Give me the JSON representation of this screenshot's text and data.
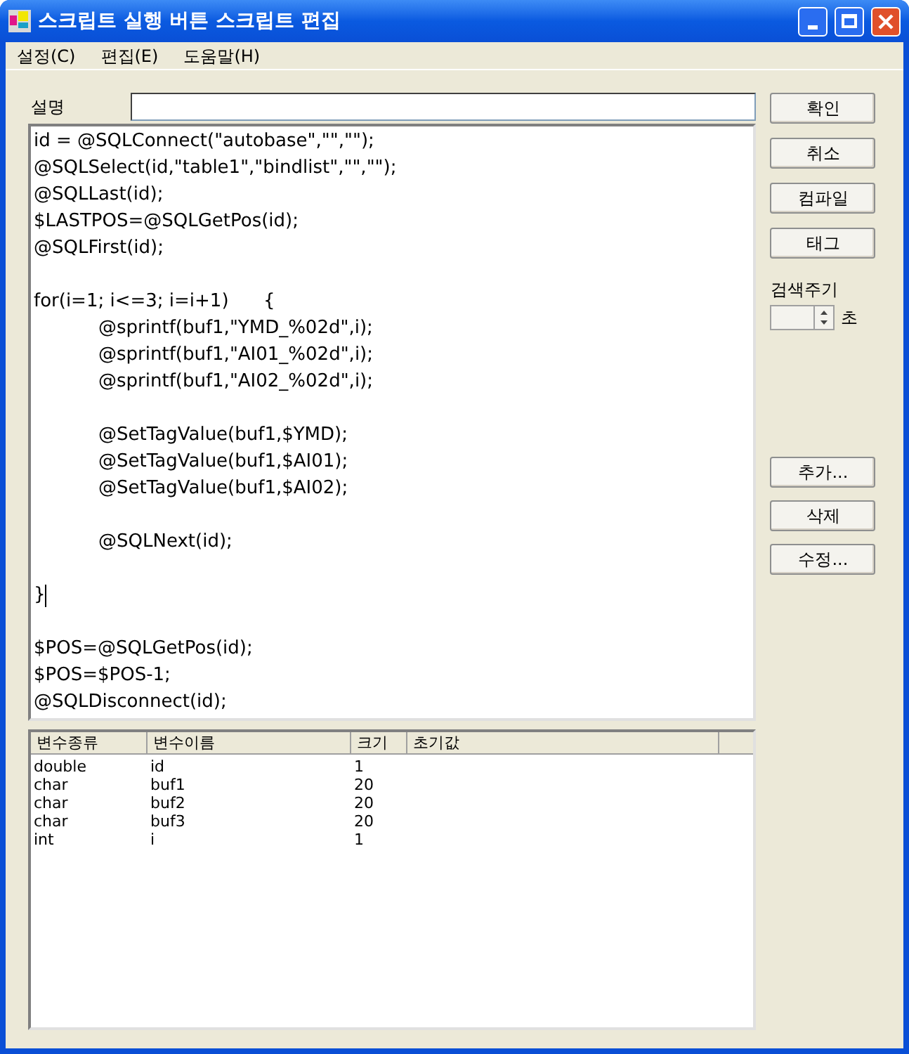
{
  "window": {
    "title": "스크립트 실행 버튼 스크립트 편집"
  },
  "menu": [
    "설정(C)",
    "편집(E)",
    "도움말(H)"
  ],
  "description": {
    "label": "설명"
  },
  "code": [
    {
      "kind": "line",
      "text": "id = @SQLConnect(\"autobase\",\"\",\"\");",
      "indent": false
    },
    {
      "kind": "line",
      "text": "@SQLSelect(id,\"table1\",\"bindlist\",\"\",\"\");",
      "indent": false
    },
    {
      "kind": "line",
      "text": "@SQLLast(id);",
      "indent": false
    },
    {
      "kind": "line",
      "text": "$LASTPOS=@SQLGetPos(id);",
      "indent": false
    },
    {
      "kind": "line",
      "text": "@SQLFirst(id);",
      "indent": false
    },
    {
      "kind": "blank"
    },
    {
      "kind": "line",
      "text": "for(i=1; i<=3; i=i+1)      {",
      "indent": false
    },
    {
      "kind": "line",
      "text": "@sprintf(buf1,\"YMD_%02d\",i);",
      "indent": true
    },
    {
      "kind": "line",
      "text": "@sprintf(buf1,\"AI01_%02d\",i);",
      "indent": true
    },
    {
      "kind": "line",
      "text": "@sprintf(buf1,\"AI02_%02d\",i);",
      "indent": true
    },
    {
      "kind": "blank"
    },
    {
      "kind": "line",
      "text": "@SetTagValue(buf1,$YMD);",
      "indent": true
    },
    {
      "kind": "line",
      "text": "@SetTagValue(buf1,$AI01);",
      "indent": true
    },
    {
      "kind": "line",
      "text": "@SetTagValue(buf1,$AI02);",
      "indent": true
    },
    {
      "kind": "blank"
    },
    {
      "kind": "line",
      "text": "@SQLNext(id);",
      "indent": true
    },
    {
      "kind": "blank"
    },
    {
      "kind": "caret",
      "text": "}",
      "indent": false
    },
    {
      "kind": "blank"
    },
    {
      "kind": "line",
      "text": "$POS=@SQLGetPos(id);",
      "indent": false
    },
    {
      "kind": "line",
      "text": "$POS=$POS-1;",
      "indent": false
    },
    {
      "kind": "line",
      "text": "@SQLDisconnect(id);",
      "indent": false
    }
  ],
  "buttons_top": [
    "확인",
    "취소",
    "컴파일",
    "태그"
  ],
  "interval": {
    "label": "검색주기",
    "unit": "초"
  },
  "buttons_bottom": [
    "추가...",
    "삭제",
    "수정..."
  ],
  "table": {
    "columns": [
      "변수종류",
      "변수이름",
      "크기",
      "초기값"
    ],
    "rows": [
      [
        "double",
        "id",
        "1"
      ],
      [
        "char",
        "buf1",
        "20"
      ],
      [
        "char",
        "buf2",
        "20"
      ],
      [
        "char",
        "buf3",
        "20"
      ],
      [
        "int",
        "i",
        "1"
      ]
    ]
  }
}
